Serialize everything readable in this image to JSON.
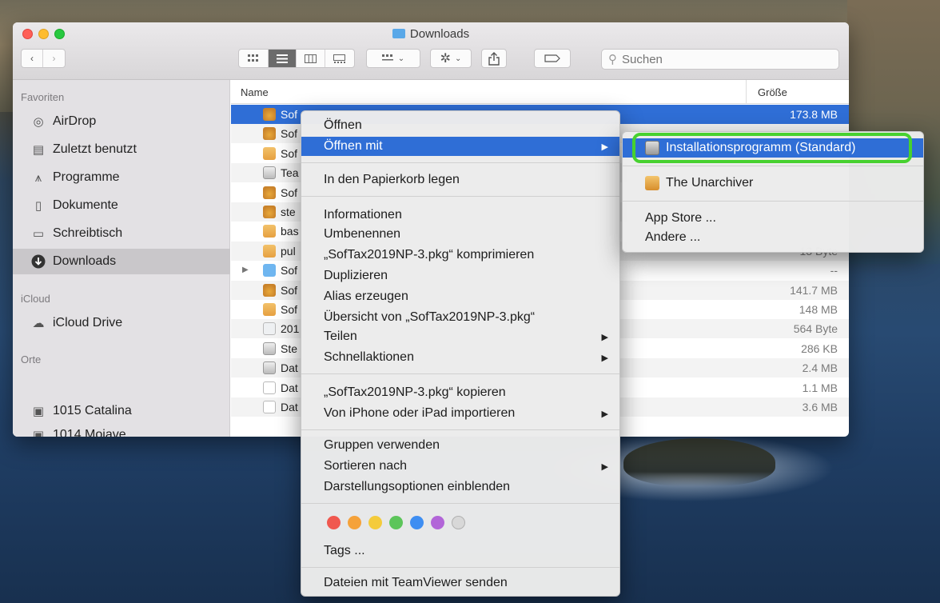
{
  "window": {
    "title": "Downloads"
  },
  "toolbar": {
    "search_placeholder": "Suchen",
    "back_label": "‹",
    "forward_label": "›"
  },
  "sidebar": {
    "favorites_label": "Favoriten",
    "favorites": [
      {
        "label": "AirDrop",
        "icon": "airdrop-icon"
      },
      {
        "label": "Zuletzt benutzt",
        "icon": "recents-icon"
      },
      {
        "label": "Programme",
        "icon": "applications-icon"
      },
      {
        "label": "Dokumente",
        "icon": "documents-icon"
      },
      {
        "label": "Schreibtisch",
        "icon": "desktop-icon"
      },
      {
        "label": "Downloads",
        "icon": "downloads-icon",
        "selected": true
      }
    ],
    "icloud_label": "iCloud",
    "icloud": [
      {
        "label": "iCloud Drive",
        "icon": "cloud-icon"
      }
    ],
    "places_label": "Orte",
    "places": [
      {
        "label": "1015 Catalina",
        "icon": "disk-icon"
      },
      {
        "label": "1014 Mojave",
        "icon": "disk-icon"
      }
    ]
  },
  "list": {
    "col_name": "Name",
    "col_size": "Größe",
    "rows": [
      {
        "name": "Sof",
        "size": "173.8 MB",
        "icon": "pkg",
        "selected": true
      },
      {
        "name": "Sof",
        "size": "",
        "icon": "pkg"
      },
      {
        "name": "Sof",
        "size": "",
        "icon": "zip"
      },
      {
        "name": "Tea",
        "size": "",
        "icon": "app"
      },
      {
        "name": "Sof",
        "size": "",
        "icon": "pkg"
      },
      {
        "name": "ste",
        "size": "",
        "icon": "pkg"
      },
      {
        "name": "bas",
        "size": "",
        "icon": "zip"
      },
      {
        "name": "pul",
        "size": "13 Byte",
        "icon": "zip"
      },
      {
        "name": "Sof",
        "size": "--",
        "icon": "folder",
        "disclosure": true
      },
      {
        "name": "Sof",
        "size": "141.7 MB",
        "icon": "pkg"
      },
      {
        "name": "Sof",
        "size": "148 MB",
        "icon": "zip"
      },
      {
        "name": "201",
        "size": "564 Byte",
        "icon": "txt"
      },
      {
        "name": "Ste",
        "size": "286 KB",
        "icon": "app"
      },
      {
        "name": "Dat",
        "size": "2.4 MB",
        "icon": "app"
      },
      {
        "name": "Dat",
        "size": "1.1 MB",
        "icon": "doc"
      },
      {
        "name": "Dat",
        "size": "3.6 MB",
        "icon": "doc"
      }
    ]
  },
  "context_menu": {
    "open": "Öffnen",
    "open_with": "Öffnen mit",
    "trash": "In den Papierkorb legen",
    "info": "Informationen",
    "rename": "Umbenennen",
    "compress": "„SofTax2019NP-3.pkg“ komprimieren",
    "duplicate": "Duplizieren",
    "alias": "Alias erzeugen",
    "quicklook": "Übersicht von „SofTax2019NP-3.pkg“",
    "share": "Teilen",
    "quick_actions": "Schnellaktionen",
    "copy": "„SofTax2019NP-3.pkg“ kopieren",
    "import": "Von iPhone oder iPad importieren",
    "groups": "Gruppen verwenden",
    "sort": "Sortieren nach",
    "view_options": "Darstellungsoptionen einblenden",
    "tags": "Tags ...",
    "teamviewer": "Dateien mit TeamViewer senden",
    "tag_colors": [
      "#f0584f",
      "#f5a23a",
      "#f4cb3b",
      "#5cc55a",
      "#3e8ef2",
      "#b265d8",
      "#d8d8d8"
    ]
  },
  "submenu": {
    "installer": "Installationsprogramm (Standard)",
    "unarchiver": "The Unarchiver",
    "app_store": "App Store ...",
    "other": "Andere ..."
  },
  "colors": {
    "selection": "#2f6ed6",
    "highlight_frame": "#47d12f"
  }
}
